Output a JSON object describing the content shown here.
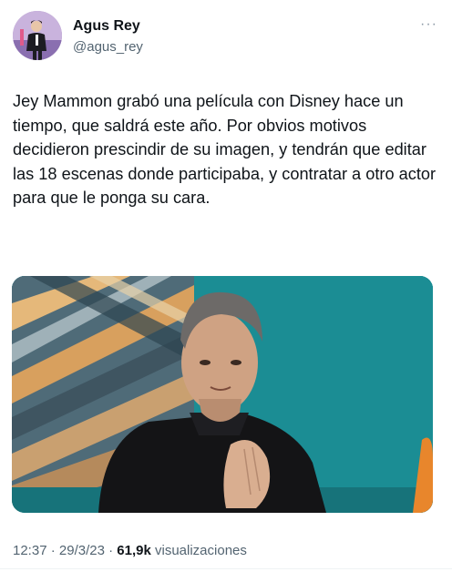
{
  "user": {
    "display_name": "Agus Rey",
    "handle": "@agus_rey",
    "avatar_icon": "profile-photo"
  },
  "more_icon": "ellipsis-icon",
  "tweet": {
    "text": "Jey Mammon grabó una película con Disney hace un tiempo, que saldrá este año. Por obvios motivos decidieron prescindir de su imagen, y tendrán que editar las 18 escenas donde participaba, y contratar a otro actor para que le ponga su cara."
  },
  "meta": {
    "time": "12:37",
    "separator": " · ",
    "date": "29/3/23",
    "views_count": "61,9k",
    "views_label": "visualizaciones"
  },
  "colors": {
    "text": "#0f1419",
    "secondary": "#536471",
    "media_background": "#1a8c93"
  }
}
